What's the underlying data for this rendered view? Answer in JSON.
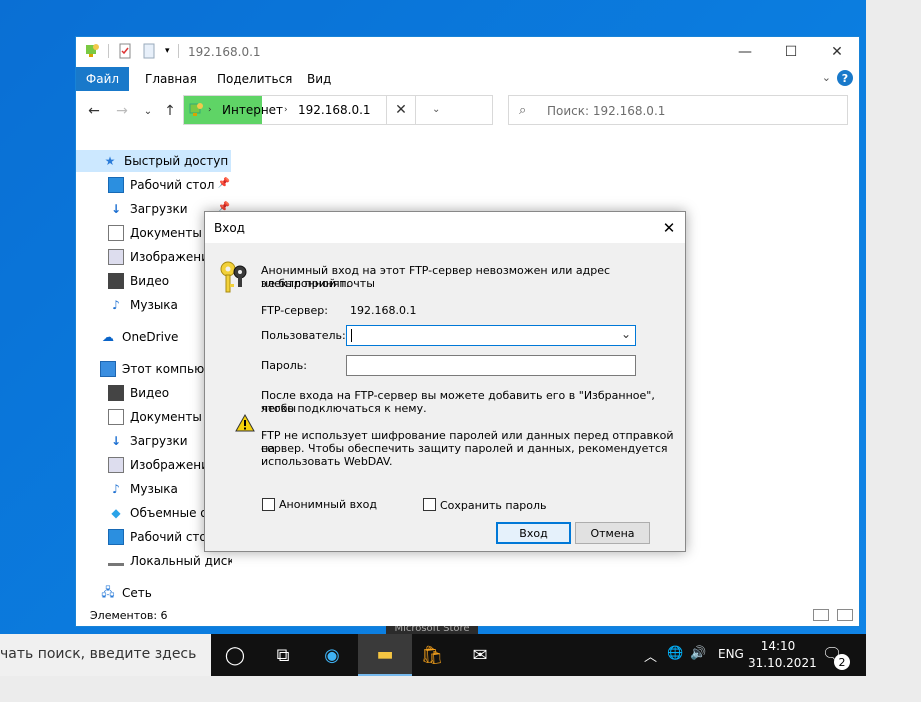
{
  "explorer": {
    "title": "192.168.0.1",
    "ribbon_tabs": {
      "file": "Файл",
      "home": "Главная",
      "share": "Поделиться",
      "view": "Вид"
    },
    "address": {
      "root": "Интернет",
      "location": "192.168.0.1"
    },
    "search_placeholder": "Поиск: 192.168.0.1",
    "sidebar": {
      "quick_access": "Быстрый доступ",
      "quick_items": [
        "Рабочий стол",
        "Загрузки",
        "Документы",
        "Изображения",
        "Видео",
        "Музыка"
      ],
      "onedrive": "OneDrive",
      "this_pc": "Этот компьютер",
      "pc_items": [
        "Видео",
        "Документы",
        "Загрузки",
        "Изображения",
        "Музыка",
        "Объемные объекты",
        "Рабочий стол",
        "Локальный диск (C:)"
      ],
      "network": "Сеть"
    },
    "status_text": "Элементов: 6"
  },
  "dialog": {
    "title": "Вход",
    "message_line1": "Анонимный вход на этот FTP-сервер невозможен или адрес электронной почты",
    "message_line2": "не был принят.",
    "server_label": "FTP-сервер:",
    "server_value": "192.168.0.1",
    "user_label": "Пользователь:",
    "user_value": "",
    "password_label": "Пароль:",
    "password_value": "",
    "info_line1": "После входа на FTP-сервер вы можете добавить его в \"Избранное\", чтобы",
    "info_line2": "легко подключаться к нему.",
    "warning_line1": "FTP не использует шифрование паролей или данных перед отправкой на",
    "warning_line2": "сервер. Чтобы обеспечить защиту паролей и данных, рекомендуется",
    "warning_line3": "использовать WebDAV.",
    "anonymous_label": "Анонимный вход",
    "anonymous_checked": false,
    "save_password_label": "Сохранить пароль",
    "save_password_checked": false,
    "login_button": "Вход",
    "cancel_button": "Отмена"
  },
  "taskbar": {
    "search_placeholder": "чать поиск, введите здесь",
    "tooltip": "Microsoft Store",
    "language": "ENG",
    "time": "14:10",
    "date": "31.10.2021",
    "notification_count": "2"
  },
  "colors": {
    "desktop": "#0078d7",
    "accent": "#1979ca",
    "address_highlight": "#5fd466",
    "selected_nav": "#cce8ff"
  }
}
